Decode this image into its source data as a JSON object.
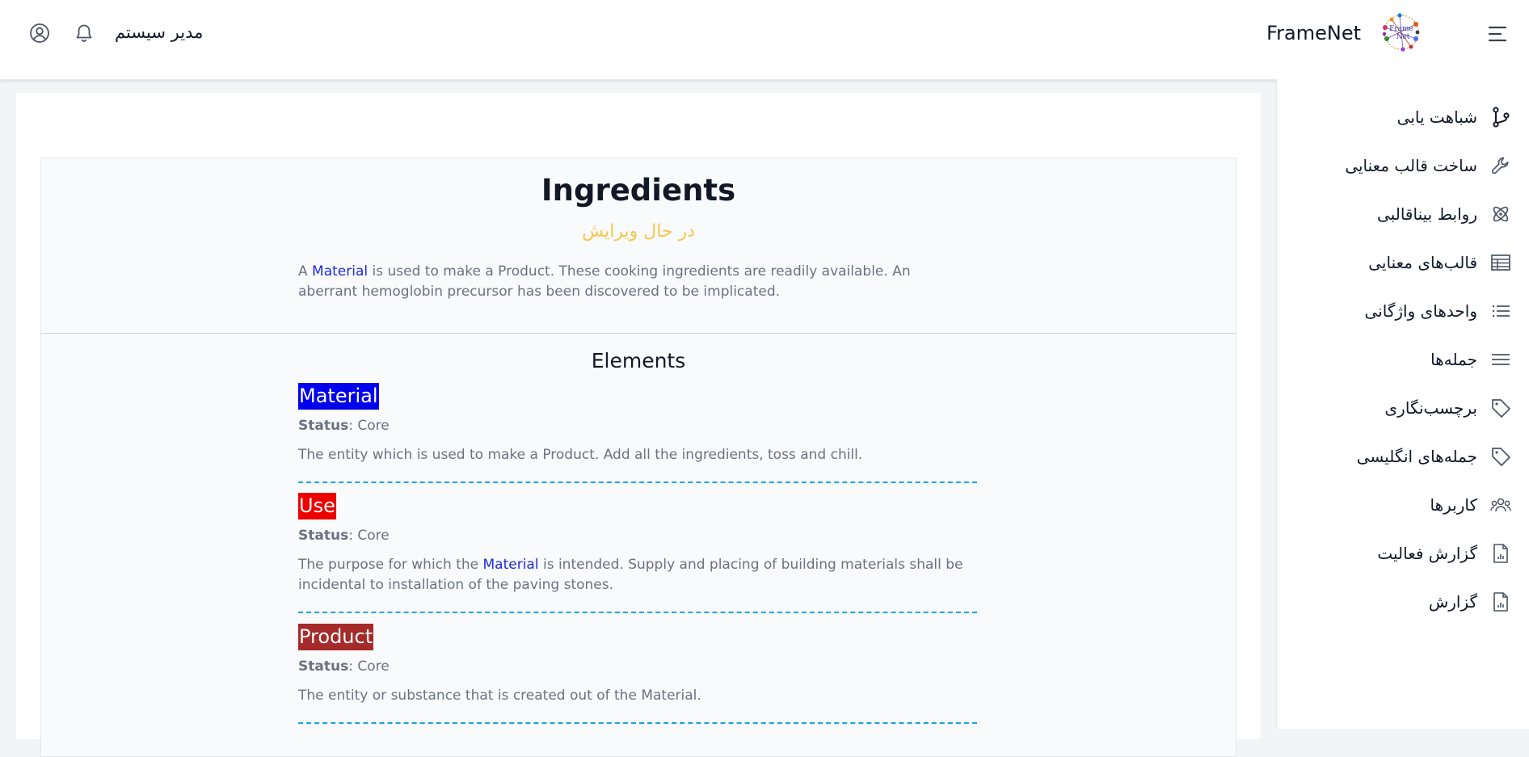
{
  "header": {
    "brand": "FrameNet",
    "user_name": "مدیر سیستم",
    "logo_text": "Frame Net"
  },
  "sidebar": {
    "items": [
      {
        "label": "شباهت یابی",
        "icon": "git-branch-icon"
      },
      {
        "label": "ساخت قالب معنایی",
        "icon": "wrench-icon"
      },
      {
        "label": "روابط بیناقالبی",
        "icon": "atom-icon"
      },
      {
        "label": "قالب‌های معنایی",
        "icon": "table-icon"
      },
      {
        "label": "واحدهای واژگانی",
        "icon": "list-icon"
      },
      {
        "label": "جمله‌ها",
        "icon": "lines-icon"
      },
      {
        "label": "برچسب‌نگاری",
        "icon": "tag-icon"
      },
      {
        "label": "جمله‌های انگلیسی",
        "icon": "tag-icon"
      },
      {
        "label": "کاربرها",
        "icon": "users-icon"
      },
      {
        "label": "گزارش فعالیت",
        "icon": "report-icon"
      },
      {
        "label": "گزارش",
        "icon": "report-icon"
      }
    ]
  },
  "frame": {
    "title": "Ingredients",
    "status": "در حال ویرایش",
    "definition": {
      "before": "A ",
      "link": "Material",
      "after": " is used to make a Product. These cooking ingredients are readily available. An aberrant hemoglobin precursor has been discovered to be implicated."
    }
  },
  "elements": {
    "title": "Elements",
    "status_label": "Status",
    "items": [
      {
        "name": "Material",
        "color": "#0000ee",
        "status": ": Core",
        "def_before": "The entity which is used to make a Product. Add all the ingredients, toss and chill.",
        "def_link": "",
        "def_after": ""
      },
      {
        "name": "Use",
        "color": "#ee0000",
        "status": ": Core",
        "def_before": "The purpose for which the ",
        "def_link": "Material",
        "def_after": " is intended. Supply and placing of building materials shall be incidental to installation of the paving stones."
      },
      {
        "name": "Product",
        "color": "#a52a2a",
        "status": ": Core",
        "def_before": "The entity or substance that is created out of the Material.",
        "def_link": "",
        "def_after": ""
      }
    ]
  }
}
